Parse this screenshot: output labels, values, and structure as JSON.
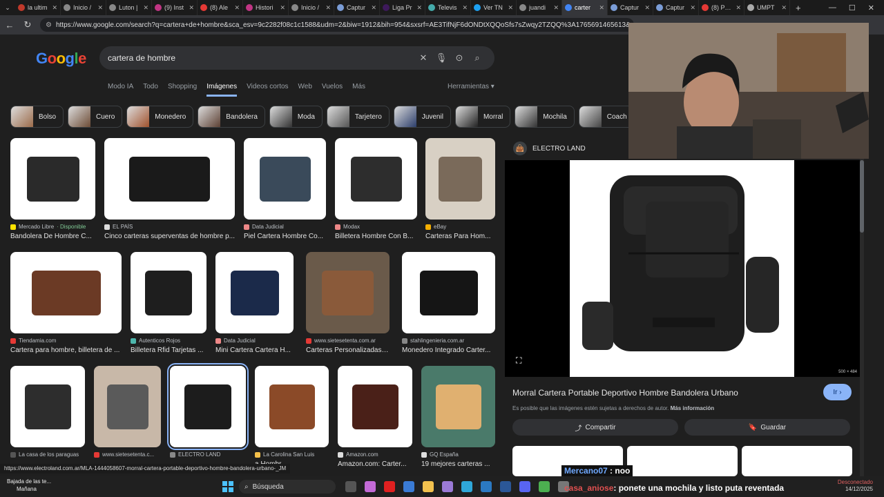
{
  "tabs": [
    {
      "label": "la ultim",
      "color": "#c0392b"
    },
    {
      "label": "Inicio /",
      "color": "#888"
    },
    {
      "label": "Luton |",
      "color": "#888"
    },
    {
      "label": "(9) Inst",
      "color": "#c13584"
    },
    {
      "label": "(8) Ale",
      "color": "#e53935"
    },
    {
      "label": "Histori",
      "color": "#c13584"
    },
    {
      "label": "Inicio /",
      "color": "#888"
    },
    {
      "label": "Captur",
      "color": "#7a9cd6"
    },
    {
      "label": "Liga Pr",
      "color": "#3d195b"
    },
    {
      "label": "Televis",
      "color": "#4aa"
    },
    {
      "label": "Ver TN",
      "color": "#1da1f2"
    },
    {
      "label": "juandi",
      "color": "#888"
    },
    {
      "label": "carter",
      "color": "#4285f4"
    },
    {
      "label": "Captur",
      "color": "#7a9cd6"
    },
    {
      "label": "Captur",
      "color": "#7a9cd6"
    },
    {
      "label": "(8) PUT",
      "color": "#e53935"
    },
    {
      "label": "UMPT",
      "color": "#aaa"
    }
  ],
  "url": "https://www.google.com/search?q=cartera+de+hombre&sca_esv=9c2282f08c1c1588&udm=2&biw=1912&bih=954&sxsrf=AE3TifNjF6dONDtXQQoSfs7sZwqy2TZQQ%3A1765691465613&ei=SVA-acm",
  "logo": "Google",
  "query": "cartera de hombre",
  "nav": [
    "Modo IA",
    "Todo",
    "Shopping",
    "Imágenes",
    "Videos cortos",
    "Web",
    "Vuelos",
    "Más"
  ],
  "nav_active": 3,
  "tools": "Herramientas",
  "chips": [
    "Bolso",
    "Cuero",
    "Monedero",
    "Bandolera",
    "Moda",
    "Tarjetero",
    "Juvenil",
    "Morral",
    "Mochila",
    "Coach"
  ],
  "results": [
    {
      "source": "Mercado Libre",
      "tag": "· Disponible",
      "title": "Bandolera De Hombre C...",
      "color": "#fde300"
    },
    {
      "source": "EL PAÍS",
      "tag": "",
      "title": "Cinco carteras superventas de hombre p...",
      "color": "#ddd"
    },
    {
      "source": "Data Judicial",
      "tag": "",
      "title": "Piel Cartera Hombre Co...",
      "color": "#e88"
    },
    {
      "source": "Modax",
      "tag": "",
      "title": "Billetera Hombre Con B...",
      "color": "#e88"
    },
    {
      "source": "eBay",
      "tag": "",
      "title": "Carteras Para Hom...",
      "color": "#f5af02"
    },
    {
      "source": "Tiendamia.com",
      "tag": "",
      "title": "Cartera para hombre, billetera de ...",
      "color": "#e53935"
    },
    {
      "source": "Autenticos Rojos",
      "tag": "",
      "title": "Billetera Rfid Tarjetas ...",
      "color": "#4db6ac"
    },
    {
      "source": "Data Judicial",
      "tag": "",
      "title": "Mini Cartera Cartera H...",
      "color": "#e88"
    },
    {
      "source": "www.sietesetenta.com.ar",
      "tag": "",
      "title": "Carteras Personalizadas C...",
      "color": "#e53935"
    },
    {
      "source": "stahlingenieria.com.ar",
      "tag": "",
      "title": "Monedero Integrado Carter...",
      "color": "#888"
    },
    {
      "source": "La casa de los paraguas",
      "tag": "",
      "title": "",
      "color": "#555"
    },
    {
      "source": "www.sietesetenta.c...",
      "tag": "",
      "title": "",
      "color": "#e53935"
    },
    {
      "source": "ELECTRO LAND",
      "tag": "",
      "title": "",
      "color": "#888"
    },
    {
      "source": "La Carolina San Luis",
      "tag": "",
      "title": "a Hombr...",
      "color": "#f5c04a"
    },
    {
      "source": "Amazon.com",
      "tag": "",
      "title": "Amazon.com: Carter...",
      "color": "#ddd"
    },
    {
      "source": "GQ España",
      "tag": "",
      "title": "19 mejores carteras ...",
      "color": "#ddd"
    }
  ],
  "panel": {
    "source": "ELECTRO LAND",
    "dims": "500 × 484",
    "title": "Morral Cartera Portable Deportivo Hombre Bandolera Urbano",
    "go": "Ir",
    "note": "Es posible que las imágenes estén sujetas a derechos de autor.",
    "note_link": "Más información",
    "share": "Compartir",
    "save": "Guardar"
  },
  "status_url": "https://www.electroland.com.ar/MLA-1444058607-morral-cartera-portable-deportivo-hombre-bandolera-urbano-_JM",
  "chat": [
    {
      "user": "Mercano07",
      "msg": " : noo"
    },
    {
      "user": "casa_aniose",
      "msg": ": ponete una mochila y listo puta reventada"
    }
  ],
  "taskbar": {
    "weather_line1": "Bajada de las te...",
    "weather_line2": "Mañana",
    "search": "Búsqueda",
    "status": "Desconectado",
    "date": "14/12/2025"
  }
}
